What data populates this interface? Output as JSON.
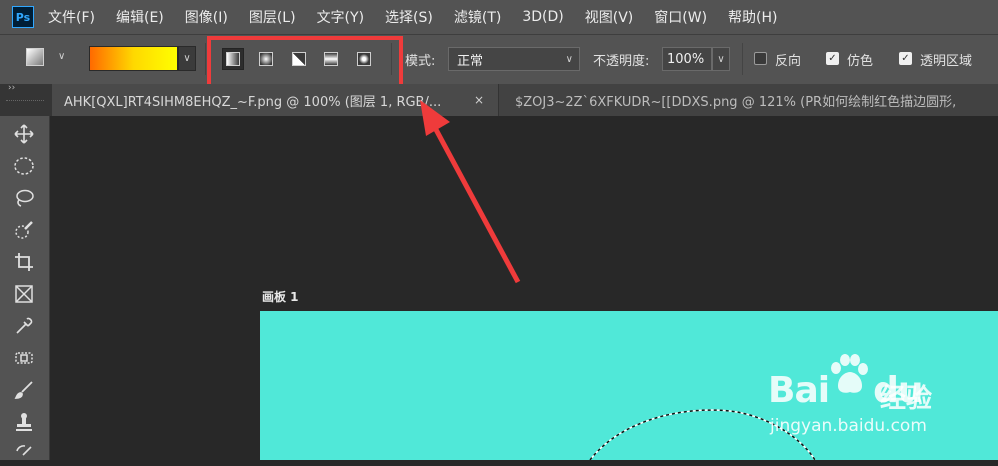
{
  "app": {
    "logo_text": "Ps"
  },
  "menubar": {
    "items": [
      {
        "label": "文件(F)"
      },
      {
        "label": "编辑(E)"
      },
      {
        "label": "图像(I)"
      },
      {
        "label": "图层(L)"
      },
      {
        "label": "文字(Y)"
      },
      {
        "label": "选择(S)"
      },
      {
        "label": "滤镜(T)"
      },
      {
        "label": "3D(D)"
      },
      {
        "label": "视图(V)"
      },
      {
        "label": "窗口(W)"
      },
      {
        "label": "帮助(H)"
      }
    ]
  },
  "options": {
    "gradient_colors": [
      "#ff6a00",
      "#ffd800",
      "#ffff00"
    ],
    "gradient_types": [
      {
        "name": "linear-gradient",
        "active": true
      },
      {
        "name": "radial-gradient",
        "active": false
      },
      {
        "name": "angle-gradient",
        "active": false
      },
      {
        "name": "reflected-gradient",
        "active": false
      },
      {
        "name": "diamond-gradient",
        "active": false
      }
    ],
    "mode_label": "模式:",
    "mode_value": "正常",
    "opacity_label": "不透明度:",
    "opacity_value": "100%",
    "reverse_label": "反向",
    "reverse_checked": false,
    "dither_label": "仿色",
    "dither_checked": true,
    "transparency_label": "透明区域",
    "transparency_checked": true,
    "highlight_color": "#ef3b3b"
  },
  "tabs": [
    {
      "label": "AHK[QXL]RT4SIHM8EHQZ_~F.png @ 100% (图层 1, RGB/...",
      "close": "×",
      "active": true
    },
    {
      "label": "$ZOJ3~2Z`6XFKUDR~[[DDXS.png @ 121% (PR如何绘制红色描边圆形,",
      "active": false
    }
  ],
  "toolbar": {
    "tools": [
      "move-icon",
      "ellipse-marquee-icon",
      "lasso-icon",
      "quick-selection-icon",
      "crop-icon",
      "frame-icon",
      "eyedropper-icon",
      "healing-brush-icon",
      "brush-icon",
      "clone-stamp-icon",
      "history-brush-icon"
    ]
  },
  "canvas": {
    "artboard_label": "画板 1",
    "artboard_color": "#50e8d8"
  },
  "watermark": {
    "brand_left": "Bai",
    "brand_right": "du",
    "chinese": "经验",
    "url": "jingyan.baidu.com"
  }
}
